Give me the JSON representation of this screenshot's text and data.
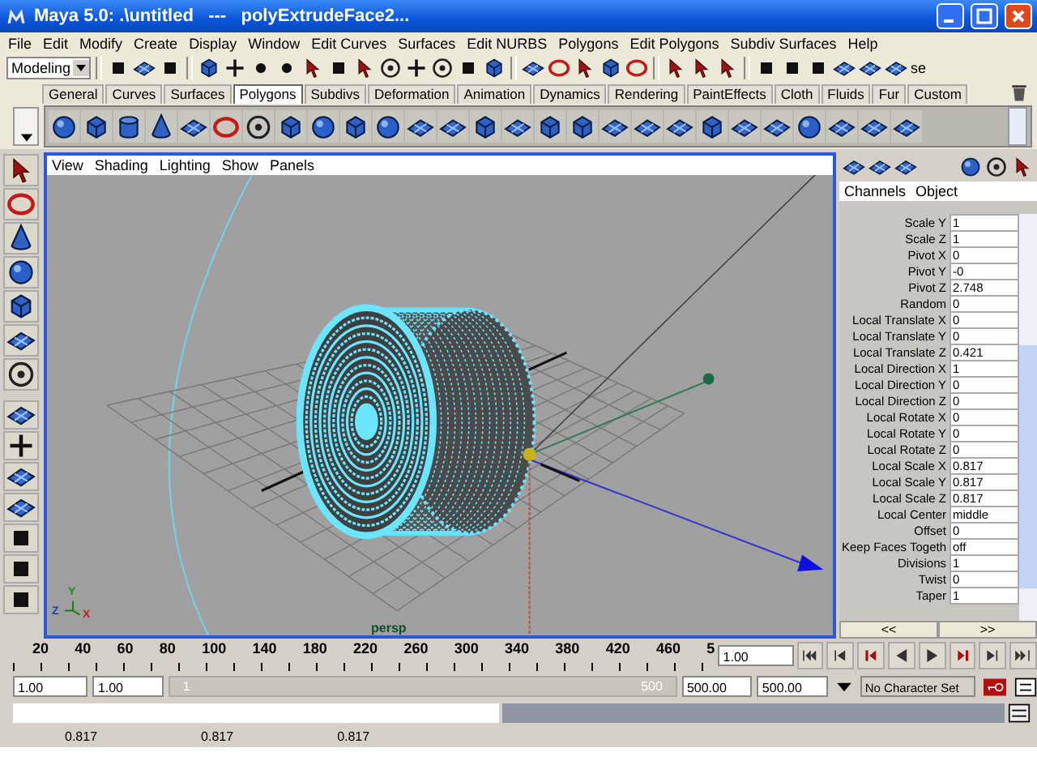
{
  "window": {
    "title": "Maya 5.0: .\\untitled   ---   polyExtrudeFace2..."
  },
  "menu_bar": [
    "File",
    "Edit",
    "Modify",
    "Create",
    "Display",
    "Window",
    "Edit Curves",
    "Surfaces",
    "Edit NURBS",
    "Polygons",
    "Edit Polygons",
    "Subdiv Surfaces",
    "Help"
  ],
  "status_line": {
    "menu_set": "Modeling",
    "text": "se"
  },
  "shelf_tabs": [
    {
      "label": "General",
      "selected": false
    },
    {
      "label": "Curves",
      "selected": false
    },
    {
      "label": "Surfaces",
      "selected": false
    },
    {
      "label": "Polygons",
      "selected": true
    },
    {
      "label": "Subdivs",
      "selected": false
    },
    {
      "label": "Deformation",
      "selected": false
    },
    {
      "label": "Animation",
      "selected": false
    },
    {
      "label": "Dynamics",
      "selected": false
    },
    {
      "label": "Rendering",
      "selected": false
    },
    {
      "label": "PaintEffects",
      "selected": false
    },
    {
      "label": "Cloth",
      "selected": false
    },
    {
      "label": "Fluids",
      "selected": false
    },
    {
      "label": "Fur",
      "selected": false
    },
    {
      "label": "Custom",
      "selected": false
    }
  ],
  "viewport": {
    "panel_menu": [
      "View",
      "Shading",
      "Lighting",
      "Show",
      "Panels"
    ],
    "camera": "persp",
    "axes": [
      "Y",
      "Z",
      "X"
    ]
  },
  "channel_box": {
    "tabs": [
      "Channels",
      "Object"
    ],
    "attributes": [
      {
        "label": "Scale Y",
        "value": "1"
      },
      {
        "label": "Scale Z",
        "value": "1"
      },
      {
        "label": "Pivot X",
        "value": "0"
      },
      {
        "label": "Pivot Y",
        "value": "-0"
      },
      {
        "label": "Pivot Z",
        "value": "2.748"
      },
      {
        "label": "Random",
        "value": "0"
      },
      {
        "label": "Local Translate X",
        "value": "0"
      },
      {
        "label": "Local Translate Y",
        "value": "0"
      },
      {
        "label": "Local Translate Z",
        "value": "0.421"
      },
      {
        "label": "Local Direction X",
        "value": "1"
      },
      {
        "label": "Local Direction Y",
        "value": "0"
      },
      {
        "label": "Local Direction Z",
        "value": "0"
      },
      {
        "label": "Local Rotate X",
        "value": "0"
      },
      {
        "label": "Local Rotate Y",
        "value": "0"
      },
      {
        "label": "Local Rotate Z",
        "value": "0"
      },
      {
        "label": "Local Scale X",
        "value": "0.817"
      },
      {
        "label": "Local Scale Y",
        "value": "0.817"
      },
      {
        "label": "Local Scale Z",
        "value": "0.817"
      },
      {
        "label": "Local Center",
        "value": "middle"
      },
      {
        "label": "Offset",
        "value": "0"
      },
      {
        "label": "Keep Faces Togeth",
        "value": "off"
      },
      {
        "label": "Divisions",
        "value": "1"
      },
      {
        "label": "Twist",
        "value": "0"
      },
      {
        "label": "Taper",
        "value": "1"
      }
    ],
    "buttons": [
      "<<",
      ">>"
    ]
  },
  "time_slider": {
    "ticks": [
      "20",
      "40",
      "60",
      "80",
      "100",
      "140",
      "180",
      "220",
      "260",
      "300",
      "340",
      "380",
      "420",
      "460",
      "5"
    ],
    "current_time": "1.00"
  },
  "range_slider": {
    "start_time": "1.00",
    "range_start": "1.00",
    "range_start_label": "1",
    "level": 1,
    "range_end_label": "500",
    "range_end": "500.00",
    "end_time": "500.00",
    "character_set": "No Character Set"
  },
  "help_line": [
    "0.817",
    "0.817",
    "0.817"
  ]
}
